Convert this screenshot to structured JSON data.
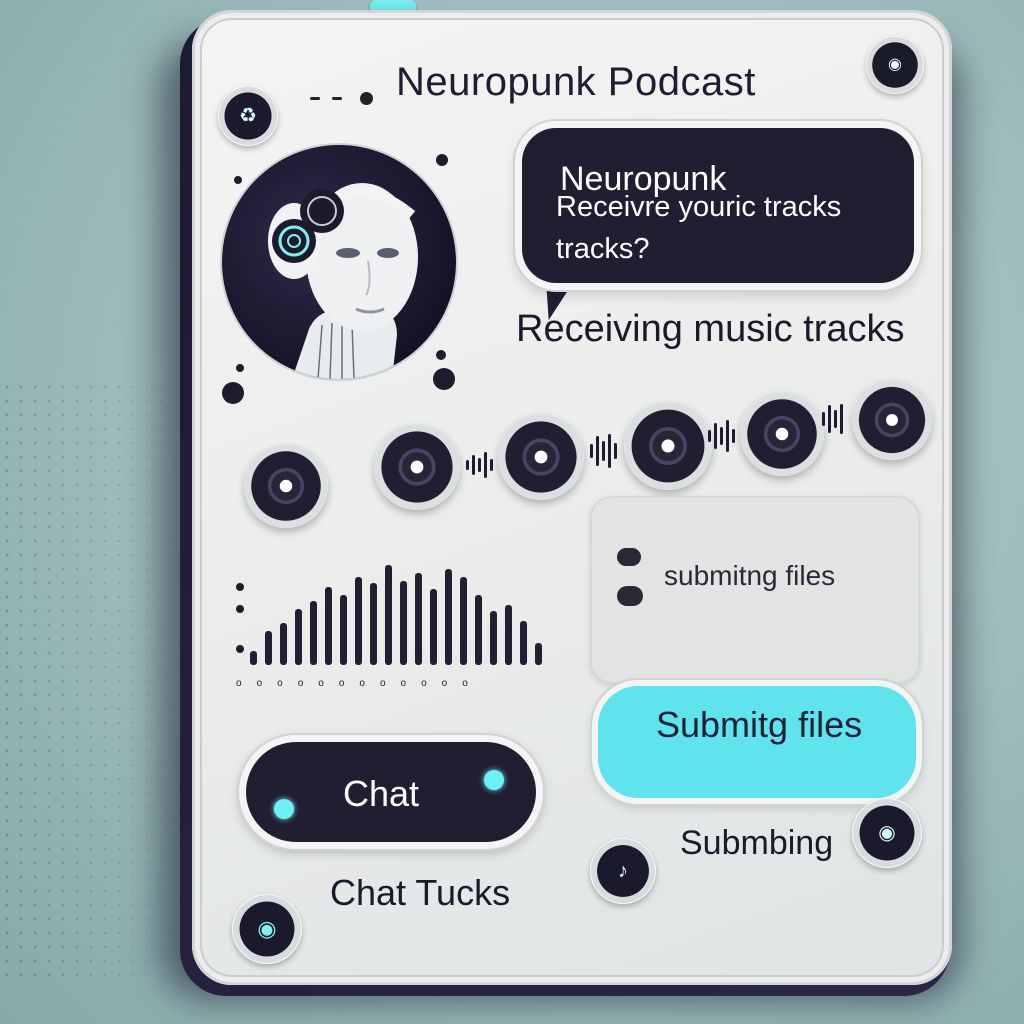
{
  "header": {
    "title": "Neuropunk Podcast"
  },
  "message_bubble": {
    "title": "Neuropunk",
    "line1": "Receivre youric tracks",
    "line2": "tracks?"
  },
  "status": {
    "subtitle": "Receiving music tracks"
  },
  "upload_card": {
    "label": "submitng files"
  },
  "buttons": {
    "submit_label": "Submitg files",
    "chat_label": "Chat"
  },
  "bottom": {
    "chat_tracks_label": "Chat Tucks",
    "submitting_label": "Submbing"
  },
  "icons": {
    "top_left_knob": "recycle-icon",
    "top_right_knob": "record-icon",
    "bottom_left_knob": "record-icon",
    "bottom_mid_knob": "music-note-icon",
    "bottom_right_knob": "record-icon"
  },
  "colors": {
    "accent": "#5fe4ee",
    "dark": "#221e32",
    "panel": "#efefef"
  }
}
